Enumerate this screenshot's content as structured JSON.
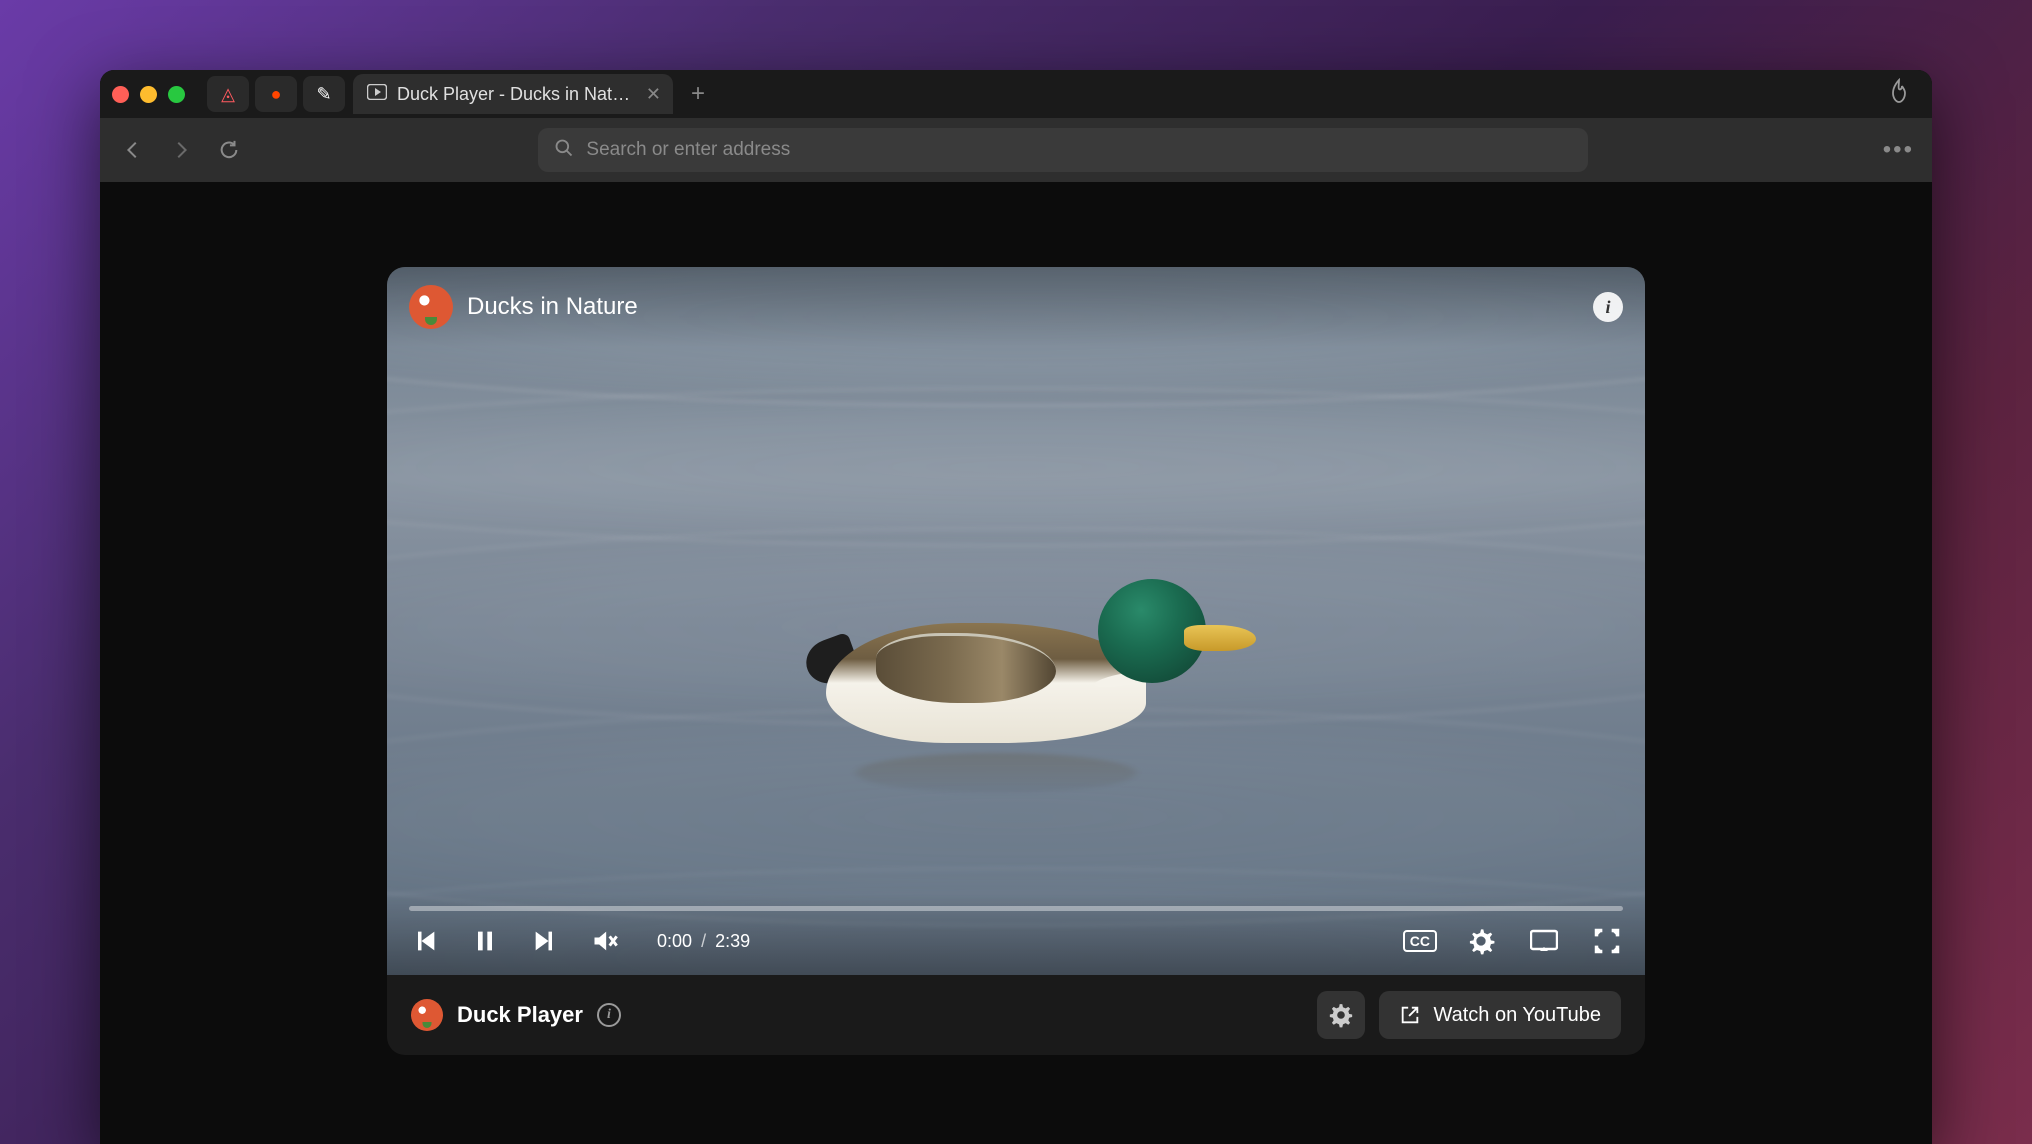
{
  "window": {
    "traffic_lights": [
      "close",
      "minimize",
      "maximize"
    ]
  },
  "tabs": {
    "pinned": [
      {
        "name": "airbnb",
        "glyph": "◬",
        "color": "#ff5a5f"
      },
      {
        "name": "reddit",
        "glyph": "●",
        "color": "#ff4500"
      },
      {
        "name": "notes",
        "glyph": "✎",
        "color": "#ffffff"
      }
    ],
    "active": {
      "title": "Duck Player - Ducks in Nature",
      "favicon": "play-rect-icon"
    }
  },
  "toolbar": {
    "address_placeholder": "Search or enter address",
    "address_value": ""
  },
  "video": {
    "title": "Ducks in Nature",
    "channel_icon": "duckduckgo-logo",
    "current_time": "0:00",
    "duration": "2:39",
    "progress_percent": 0,
    "cc_label": "CC"
  },
  "player_bar": {
    "app_name": "Duck Player",
    "watch_label": "Watch on YouTube"
  },
  "icons": {
    "prev": "skip-previous-icon",
    "pause": "pause-icon",
    "next": "skip-next-icon",
    "mute": "volume-muted-icon",
    "cc": "closed-captions-icon",
    "gear": "gear-icon",
    "cast": "cast-icon",
    "fullscreen": "fullscreen-icon",
    "info": "info-icon",
    "external": "external-link-icon",
    "flame": "fire-icon",
    "search": "search-icon",
    "more": "more-icon"
  },
  "colors": {
    "accent": "#de5833",
    "window_bg": "#0c0c0c",
    "toolbar_bg": "#2e2e2e"
  }
}
